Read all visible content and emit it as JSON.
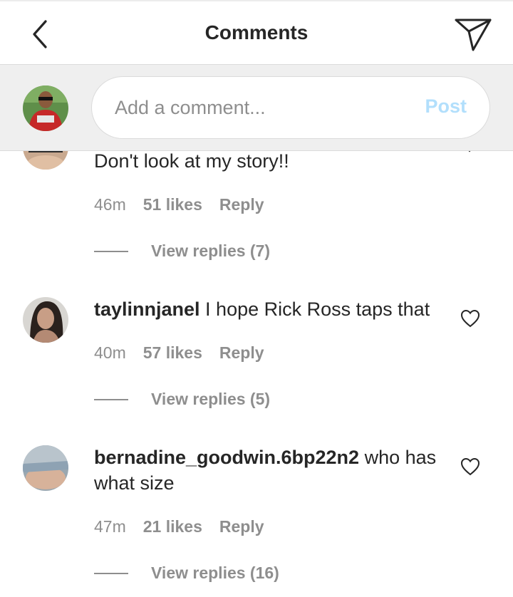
{
  "header": {
    "title": "Comments",
    "back_icon": "chevron-left-icon",
    "send_icon": "paper-plane-icon"
  },
  "composer": {
    "placeholder": "Add a comment...",
    "post_label": "Post",
    "post_color": "#b2dffc"
  },
  "comments": [
    {
      "username": "",
      "text": "Don't look at my story!!",
      "time": "46m",
      "likes": "51 likes",
      "reply": "Reply",
      "view_replies": "View replies (7)"
    },
    {
      "username": "taylinnjanel",
      "text": " I hope Rick Ross taps that",
      "time": "40m",
      "likes": "57 likes",
      "reply": "Reply",
      "view_replies": "View replies (5)"
    },
    {
      "username": "bernadine_goodwin.6bp22n2",
      "text": " who has what size",
      "time": "47m",
      "likes": "21 likes",
      "reply": "Reply",
      "view_replies": "View replies (16)"
    }
  ],
  "colors": {
    "text_primary": "#262626",
    "text_secondary": "#8e8e8e",
    "composer_bg": "#efefef"
  }
}
